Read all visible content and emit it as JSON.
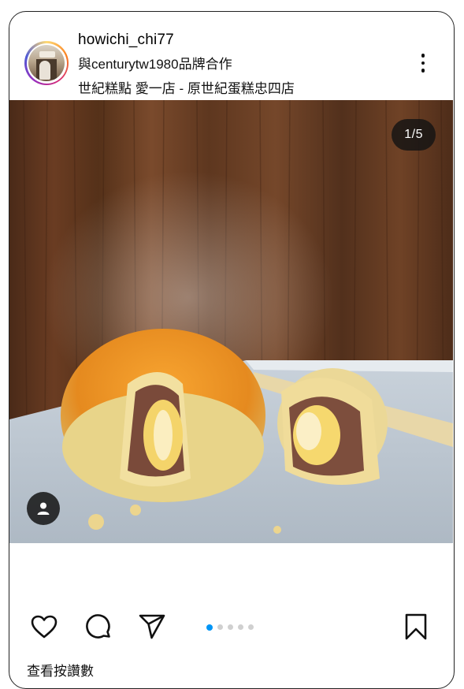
{
  "post": {
    "username": "howichi_chi77",
    "partnership": "與centurytw1980品牌合作",
    "location": "世紀糕點 愛一店 - 原世紀蛋糕忠四店",
    "media_counter": "1/5",
    "carousel": {
      "total": 5,
      "current": 1
    },
    "view_likes_label": "查看按讚數"
  },
  "icons": {
    "avatar": "profile-avatar",
    "more": "more-options-icon",
    "tag": "person-tag-icon",
    "like": "heart-icon",
    "comment": "comment-icon",
    "share": "send-icon",
    "save": "bookmark-icon"
  },
  "colors": {
    "accent": "#0095f6",
    "text": "#111111",
    "background": "#ffffff"
  }
}
